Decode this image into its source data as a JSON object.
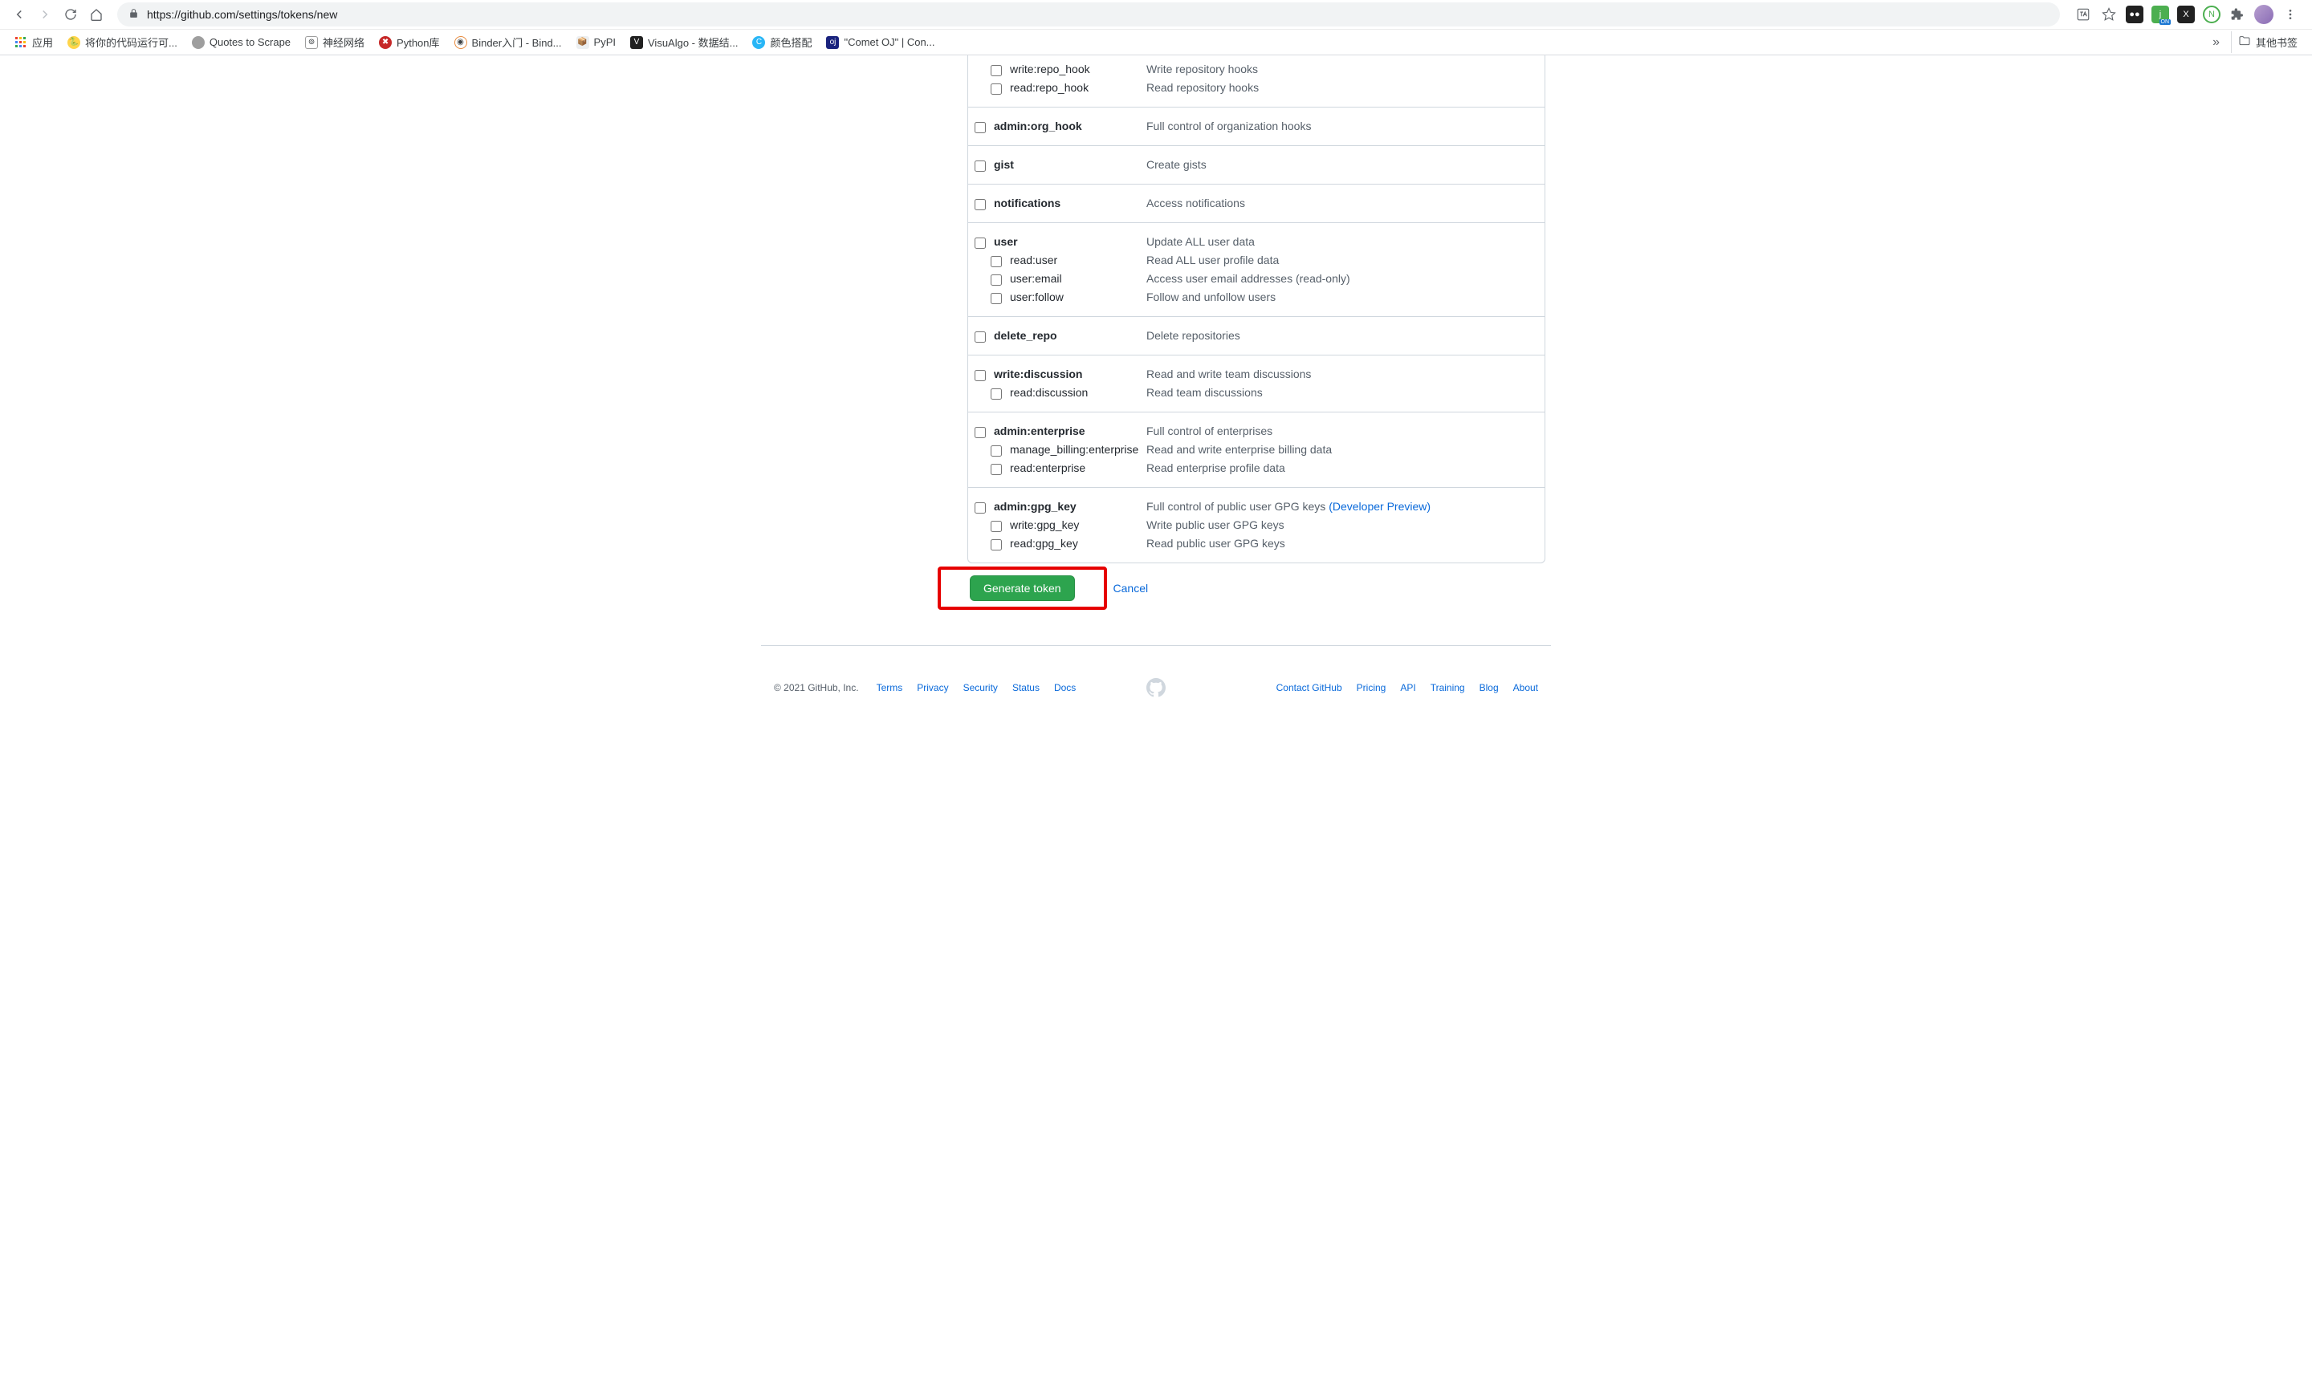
{
  "browser": {
    "url": "https://github.com/settings/tokens/new",
    "bookmarks": [
      {
        "label": "应用",
        "icon_bg": "#fff"
      },
      {
        "label": "将你的代码运行可...",
        "icon_bg": "#ffd54a"
      },
      {
        "label": "Quotes to Scrape",
        "icon_bg": "#757575"
      },
      {
        "label": "神经网络",
        "icon_bg": "#616161"
      },
      {
        "label": "Python库",
        "icon_bg": "#c62828"
      },
      {
        "label": "Binder入门 - Bind...",
        "icon_bg": "#e88b3f"
      },
      {
        "label": "PyPI",
        "icon_bg": "#eceff1"
      },
      {
        "label": "VisuAlgo - 数据结...",
        "icon_bg": "#212121"
      },
      {
        "label": "颜色搭配",
        "icon_bg": "#29b6f6"
      },
      {
        "label": "\"Comet OJ\" | Con...",
        "icon_bg": "#1a237e"
      }
    ],
    "more": "»",
    "other_bookmarks": "其他书签"
  },
  "scopes": [
    {
      "items": [
        {
          "name": "write:repo_hook",
          "desc": "Write repository hooks",
          "child": true
        },
        {
          "name": "read:repo_hook",
          "desc": "Read repository hooks",
          "child": true
        }
      ]
    },
    {
      "items": [
        {
          "name": "admin:org_hook",
          "desc": "Full control of organization hooks",
          "child": false
        }
      ]
    },
    {
      "items": [
        {
          "name": "gist",
          "desc": "Create gists",
          "child": false
        }
      ]
    },
    {
      "items": [
        {
          "name": "notifications",
          "desc": "Access notifications",
          "child": false
        }
      ]
    },
    {
      "items": [
        {
          "name": "user",
          "desc": "Update ALL user data",
          "child": false
        },
        {
          "name": "read:user",
          "desc": "Read ALL user profile data",
          "child": true
        },
        {
          "name": "user:email",
          "desc": "Access user email addresses (read-only)",
          "child": true
        },
        {
          "name": "user:follow",
          "desc": "Follow and unfollow users",
          "child": true
        }
      ]
    },
    {
      "items": [
        {
          "name": "delete_repo",
          "desc": "Delete repositories",
          "child": false
        }
      ]
    },
    {
      "items": [
        {
          "name": "write:discussion",
          "desc": "Read and write team discussions",
          "child": false
        },
        {
          "name": "read:discussion",
          "desc": "Read team discussions",
          "child": true
        }
      ]
    },
    {
      "items": [
        {
          "name": "admin:enterprise",
          "desc": "Full control of enterprises",
          "child": false
        },
        {
          "name": "manage_billing:enterprise",
          "desc": "Read and write enterprise billing data",
          "child": true
        },
        {
          "name": "read:enterprise",
          "desc": "Read enterprise profile data",
          "child": true
        }
      ]
    },
    {
      "items": [
        {
          "name": "admin:gpg_key",
          "desc": "Full control of public user GPG keys ",
          "child": false,
          "link": "(Developer Preview)"
        },
        {
          "name": "write:gpg_key",
          "desc": "Write public user GPG keys",
          "child": true
        },
        {
          "name": "read:gpg_key",
          "desc": "Read public user GPG keys",
          "child": true
        }
      ]
    }
  ],
  "actions": {
    "generate": "Generate token",
    "cancel": "Cancel"
  },
  "footer": {
    "copyright": "© 2021 GitHub, Inc.",
    "left": [
      "Terms",
      "Privacy",
      "Security",
      "Status",
      "Docs"
    ],
    "right": [
      "Contact GitHub",
      "Pricing",
      "API",
      "Training",
      "Blog",
      "About"
    ]
  }
}
